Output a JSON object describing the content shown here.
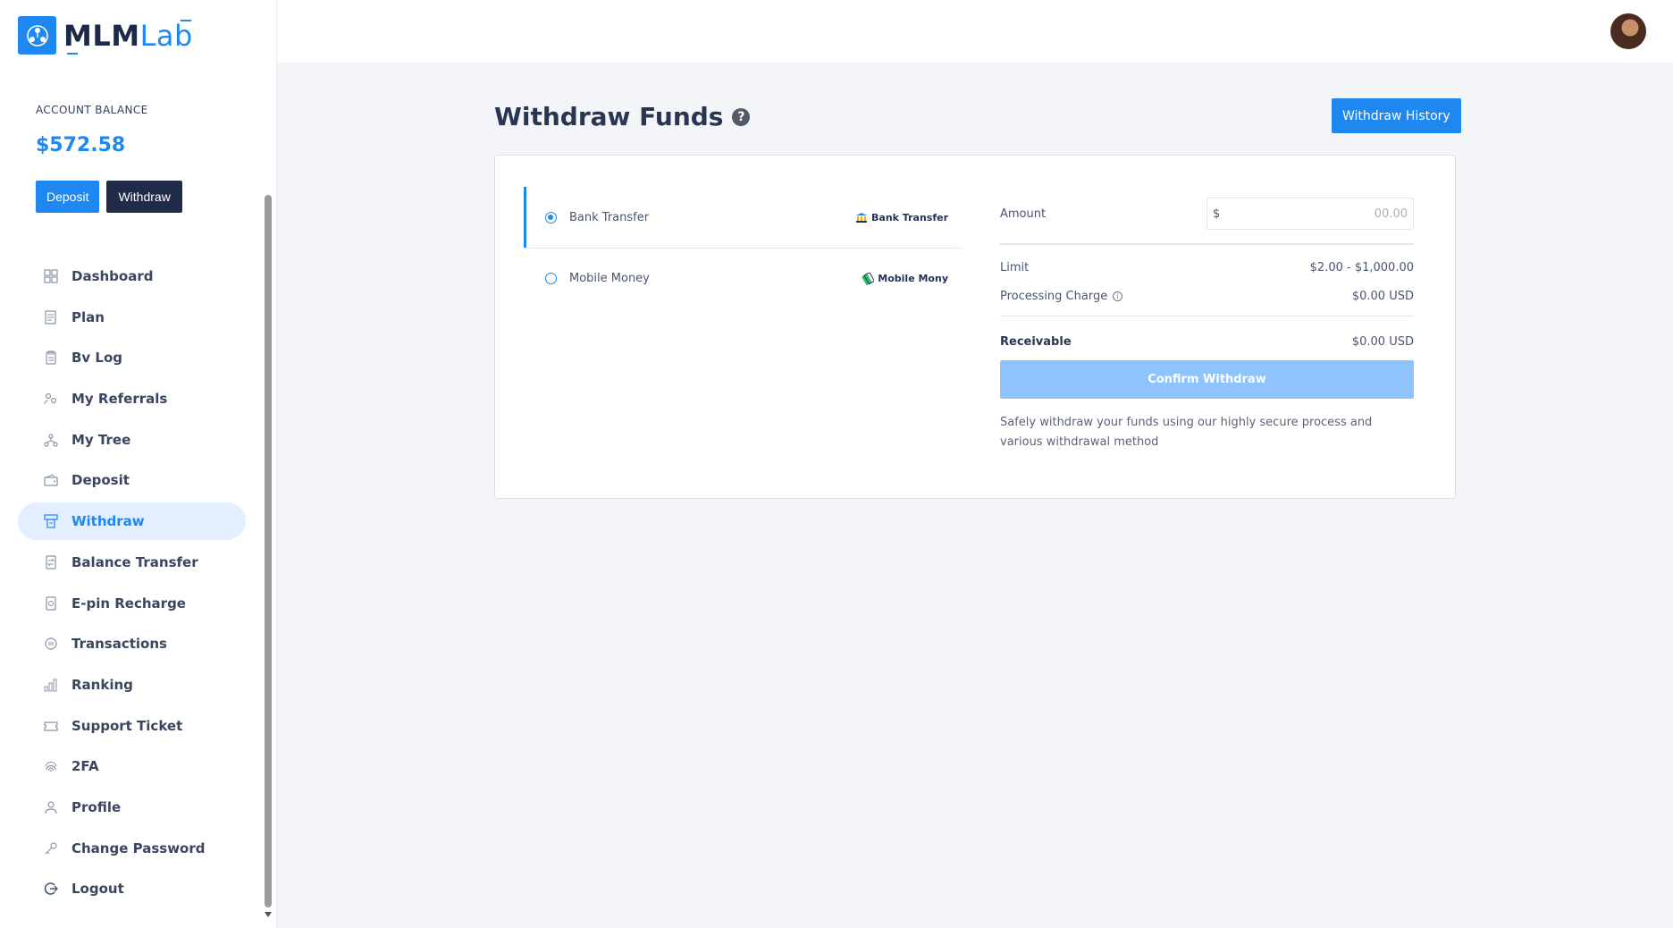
{
  "app": {
    "logo_part1": "MLM",
    "logo_part2": "Lab"
  },
  "balance": {
    "label": "ACCOUNT BALANCE",
    "value": "$572.58",
    "deposit_label": "Deposit",
    "withdraw_label": "Withdraw"
  },
  "menu": [
    {
      "label": "Dashboard",
      "icon": "dashboard-icon"
    },
    {
      "label": "Plan",
      "icon": "plan-icon"
    },
    {
      "label": "Bv Log",
      "icon": "bv-log-icon"
    },
    {
      "label": "My Referrals",
      "icon": "referrals-icon"
    },
    {
      "label": "My Tree",
      "icon": "tree-icon"
    },
    {
      "label": "Deposit",
      "icon": "deposit-icon"
    },
    {
      "label": "Withdraw",
      "icon": "withdraw-icon",
      "active": true
    },
    {
      "label": "Balance Transfer",
      "icon": "balance-transfer-icon"
    },
    {
      "label": "E-pin Recharge",
      "icon": "epin-icon"
    },
    {
      "label": "Transactions",
      "icon": "transactions-icon"
    },
    {
      "label": "Ranking",
      "icon": "ranking-icon"
    },
    {
      "label": "Support Ticket",
      "icon": "ticket-icon"
    },
    {
      "label": "2FA",
      "icon": "fingerprint-icon"
    },
    {
      "label": "Profile",
      "icon": "profile-icon"
    },
    {
      "label": "Change Password",
      "icon": "key-icon"
    },
    {
      "label": "Logout",
      "icon": "logout-icon"
    }
  ],
  "page": {
    "title": "Withdraw Funds",
    "history_button": "Withdraw History"
  },
  "methods": [
    {
      "name": "Bank Transfer",
      "logo_text": "Bank Transfer",
      "selected": true
    },
    {
      "name": "Mobile Money",
      "logo_text": "Mobile Mony",
      "selected": false
    }
  ],
  "form": {
    "amount_label": "Amount",
    "currency_symbol": "$",
    "amount_placeholder": "00.00",
    "limit_label": "Limit",
    "limit_value": "$2.00 - $1,000.00",
    "charge_label": "Processing Charge",
    "charge_value": "$0.00 USD",
    "receivable_label": "Receivable",
    "receivable_value": "$0.00 USD",
    "confirm_label": "Confirm Withdraw",
    "note": "Safely withdraw your funds using our highly secure process and various withdrawal method"
  },
  "colors": {
    "primary": "#1f87f0",
    "dark": "#1f2b49",
    "confirm_disabled": "#8ec3fb",
    "active_bg": "#e3efff"
  }
}
